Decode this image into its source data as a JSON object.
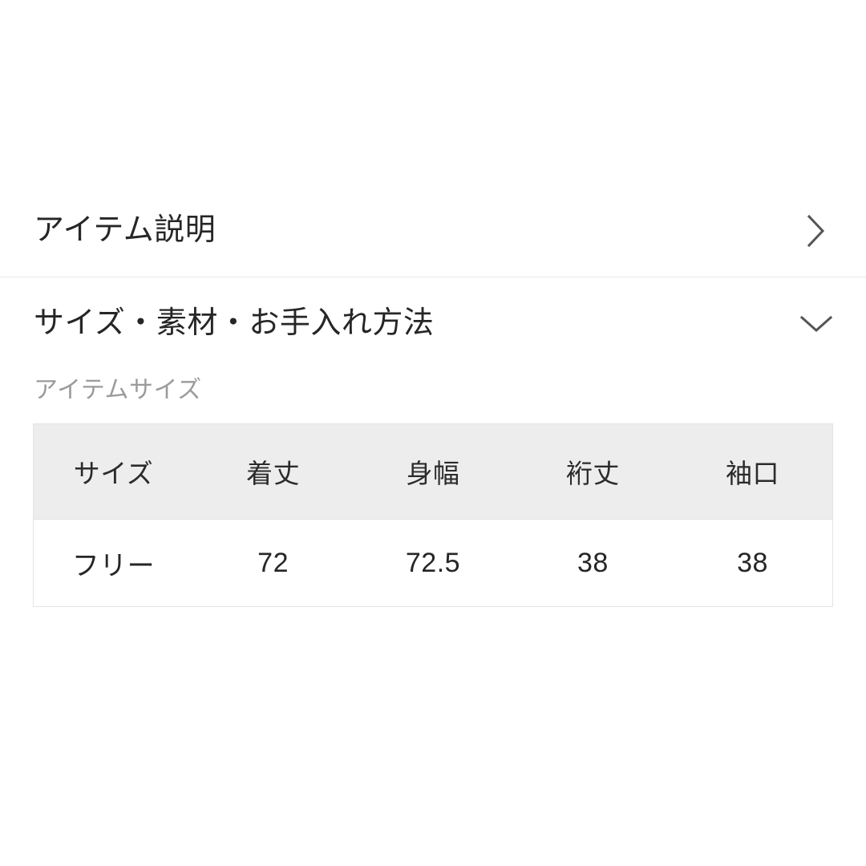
{
  "sections": [
    {
      "id": "item-description",
      "title": "アイテム説明",
      "chevron": "chevron-right-icon",
      "expanded": false
    },
    {
      "id": "size-material-care",
      "title": "サイズ・素材・お手入れ方法",
      "chevron": "chevron-down-icon",
      "expanded": true
    }
  ],
  "size_panel": {
    "subtitle": "アイテムサイズ",
    "table": {
      "headers": [
        "サイズ",
        "着丈",
        "身幅",
        "裄丈",
        "袖口"
      ],
      "rows": [
        [
          "フリー",
          "72",
          "72.5",
          "38",
          "38"
        ]
      ]
    }
  },
  "colors": {
    "background": "#ffffff",
    "text_primary": "#262626",
    "text_muted": "#9b9b9b",
    "divider": "#e6e6e6",
    "table_header_bg": "#ededed",
    "table_border": "#e4e4e4",
    "chevron": "#555555"
  }
}
